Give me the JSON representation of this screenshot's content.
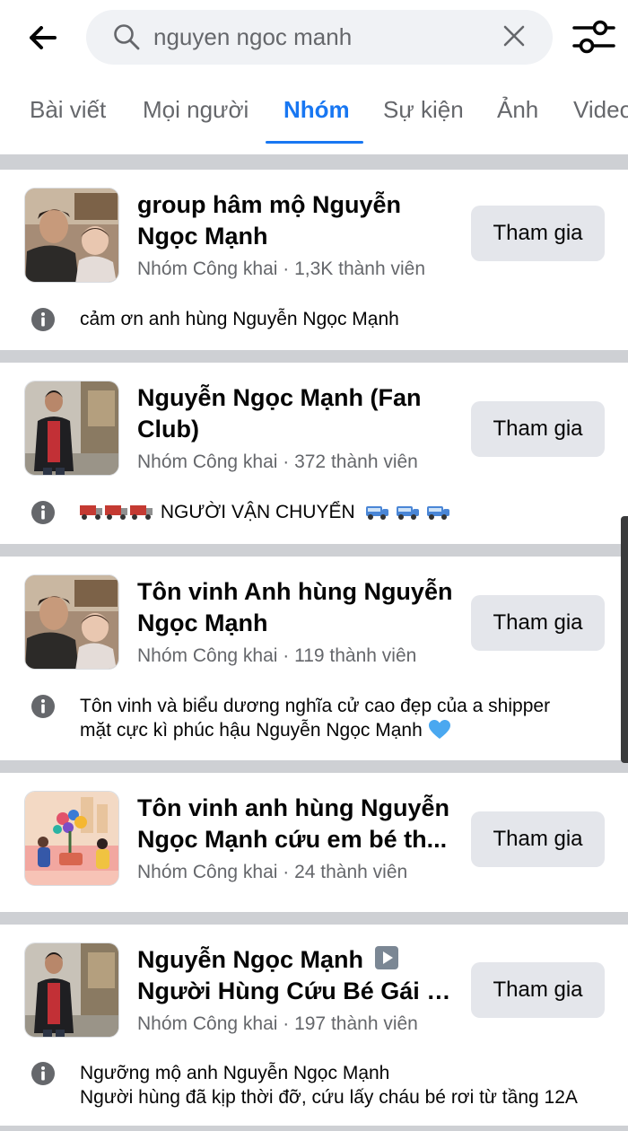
{
  "search": {
    "value": "nguyen ngoc manh"
  },
  "tabs": [
    {
      "label": "Bài viết"
    },
    {
      "label": "Mọi người"
    },
    {
      "label": "Nhóm"
    },
    {
      "label": "Sự kiện"
    },
    {
      "label": "Ảnh"
    },
    {
      "label": "Video"
    }
  ],
  "active_tab": "Nhóm",
  "colors": {
    "accent": "#1877f2",
    "button_bg": "#e4e6eb",
    "meta_text": "#65676b",
    "separator": "#ced0d4",
    "heart": "#4aa8f0"
  },
  "groups": [
    {
      "name_line1": "group hâm mộ Nguyễn",
      "name_line2": "Ngọc Mạnh",
      "meta": "Nhóm Công khai · 1,3K thành viên",
      "join_label": "Tham gia",
      "description": "cảm ơn anh hùng Nguyễn Ngọc Mạnh",
      "thumbnail": "man-holding-baby-photo"
    },
    {
      "name_line1": "Nguyễn Ngọc Mạnh (Fan",
      "name_line2": "Club)",
      "meta": "Nhóm Công khai · 372 thành viên",
      "join_label": "Tham gia",
      "description": "NGƯỜI VẬN CHUYỂN",
      "description_icons": [
        "truck-icon",
        "truck-icon",
        "truck-icon",
        "delivery-van-icon",
        "delivery-van-icon",
        "delivery-van-icon"
      ],
      "thumbnail": "man-standing-photo"
    },
    {
      "name_line1": "Tôn vinh Anh hùng Nguyễn",
      "name_line2": "Ngọc Mạnh",
      "meta": "Nhóm Công khai · 119 thành viên",
      "join_label": "Tham gia",
      "description_line1": "Tôn vinh và biểu dương nghĩa cử cao đẹp của a shipper",
      "description_line2": "mặt cực kì phúc hậu Nguyễn Ngọc Mạnh",
      "description_icon": "blue-heart-icon",
      "thumbnail": "man-holding-baby-photo"
    },
    {
      "name_line1": "Tôn vinh anh hùng Nguyễn",
      "name_line2": "Ngọc Mạnh cứu em bé th...",
      "meta": "Nhóm Công khai · 24 thành viên",
      "join_label": "Tham gia",
      "thumbnail": "group-default-illustration"
    },
    {
      "name_line1": "Nguyễn Ngọc Mạnh",
      "name_line1_icon": "play-button-icon",
      "name_line2": "Người Hùng Cứu Bé Gái R...",
      "meta": "Nhóm Công khai · 197 thành viên",
      "join_label": "Tham gia",
      "description_line1": "Ngưỡng mộ anh Nguyễn Ngọc Mạnh",
      "description_line2": "Người hùng đã kịp thời đỡ, cứu lấy cháu bé rơi từ tầng 12A",
      "thumbnail": "man-standing-photo"
    }
  ]
}
